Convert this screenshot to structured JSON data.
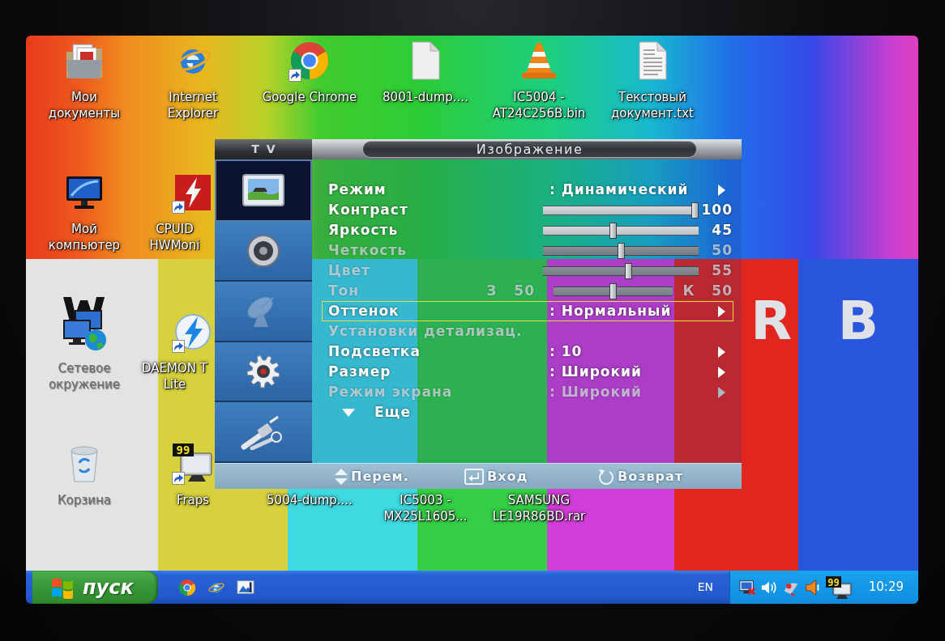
{
  "wallpaper": {
    "bars": [
      {
        "color": "#e3e3e1"
      },
      {
        "color": "#d6d13c"
      },
      {
        "color": "#3fd9e2"
      },
      {
        "color": "#34cf46"
      },
      {
        "color": "#d23fd8"
      },
      {
        "color": "#e1261f",
        "letter": "R"
      },
      {
        "color": "#2a56de",
        "letter": "B"
      }
    ]
  },
  "desktop": {
    "icons": [
      {
        "kind": "documents",
        "shortcut": false,
        "label": [
          "Мои",
          "документы"
        ]
      },
      {
        "kind": "ie",
        "shortcut": false,
        "label": [
          "Internet",
          "Explorer"
        ]
      },
      {
        "kind": "chrome",
        "shortcut": true,
        "label": [
          "Google Chrome"
        ]
      },
      {
        "kind": "file",
        "shortcut": false,
        "label": [
          "8001-dump...."
        ]
      },
      {
        "kind": "vlc",
        "shortcut": false,
        "label": [
          "IC5004 -",
          "AT24C256B.bin"
        ]
      },
      {
        "kind": "text",
        "shortcut": false,
        "label": [
          "Текстовый",
          "документ.txt"
        ]
      },
      {
        "kind": "computer",
        "shortcut": false,
        "label": [
          "Мой",
          "компьютер"
        ]
      },
      {
        "kind": "cpuid",
        "shortcut": true,
        "label": [
          "CPUID",
          "HWMoni"
        ]
      },
      {
        "kind": "network",
        "shortcut": false,
        "label": [
          "Сетевое",
          "окружение"
        ]
      },
      {
        "kind": "daemon",
        "shortcut": true,
        "label": [
          "DAEMON T",
          "Lite"
        ]
      },
      {
        "kind": "recycle",
        "shortcut": false,
        "label": [
          "Корзина"
        ]
      },
      {
        "kind": "fraps",
        "shortcut": true,
        "icon_text": "99",
        "label": [
          "Fraps"
        ]
      },
      {
        "label": [
          "5004-dump...."
        ]
      },
      {
        "label": [
          "IC5003 -",
          "MX25L1605..."
        ]
      },
      {
        "label": [
          "SAMSUNG",
          "LE19R86BD.rar"
        ]
      }
    ]
  },
  "osd": {
    "source": "TV",
    "title": "Изображение",
    "tabs": [
      {
        "kind": "picture",
        "selected": true,
        "disabled": false
      },
      {
        "kind": "sound",
        "selected": false,
        "disabled": false
      },
      {
        "kind": "channel",
        "selected": false,
        "disabled": true
      },
      {
        "kind": "setup",
        "selected": false,
        "disabled": false
      },
      {
        "kind": "input",
        "selected": false,
        "disabled": false
      }
    ],
    "rows": [
      {
        "kind": "option",
        "label": "Режим",
        "value": ": Динамический",
        "arrow": true,
        "selected": false,
        "disabled": false
      },
      {
        "kind": "slider",
        "label": "Контраст",
        "level": 1,
        "reading": "100",
        "selected": false,
        "disabled": false
      },
      {
        "kind": "slider",
        "label": "Яркость",
        "level": 0.45,
        "reading": "45",
        "selected": false,
        "disabled": false
      },
      {
        "kind": "slider",
        "label": "Четкость",
        "level": 0.5,
        "reading": "50",
        "selected": false,
        "disabled": true
      },
      {
        "kind": "slider",
        "label": "Цвет",
        "level": 0.55,
        "reading": "55",
        "selected": false,
        "disabled": true
      },
      {
        "kind": "balance",
        "label": "Тон",
        "left": "З 50",
        "right": "К 50",
        "level": 0.5,
        "selected": false,
        "disabled": true
      },
      {
        "kind": "option",
        "label": "Оттенок",
        "value": ": Нормальный",
        "arrow": true,
        "selected": true,
        "disabled": false
      },
      {
        "kind": "option",
        "label": "Установки детализац.",
        "arrow": false,
        "selected": false,
        "disabled": true
      },
      {
        "kind": "option",
        "label": "Подсветка",
        "value": ": 10",
        "arrow": true,
        "selected": false,
        "disabled": false
      },
      {
        "kind": "option",
        "label": "Размер",
        "value": ": Широкий",
        "arrow": true,
        "selected": false,
        "disabled": false
      },
      {
        "kind": "option",
        "label": "Режим экрана",
        "value": ": Широкий",
        "arrow": true,
        "selected": false,
        "disabled": true
      },
      {
        "kind": "more",
        "label": "Еще",
        "selected": false,
        "disabled": false
      }
    ],
    "hints": [
      {
        "kind": "move",
        "label": "Перем."
      },
      {
        "kind": "enter",
        "label": "Вход"
      },
      {
        "kind": "return",
        "label": "Возврат"
      }
    ]
  },
  "taskbar": {
    "start": "пуск",
    "quick_launch": [
      {
        "kind": "chrome"
      },
      {
        "kind": "ie"
      },
      {
        "kind": "desktop"
      }
    ],
    "language": "EN",
    "tray": [
      {
        "kind": "network"
      },
      {
        "kind": "volume"
      },
      {
        "kind": "dish"
      },
      {
        "kind": "speaker"
      },
      {
        "kind": "fraps",
        "icon_text": "99"
      }
    ],
    "clock": "10:29"
  }
}
